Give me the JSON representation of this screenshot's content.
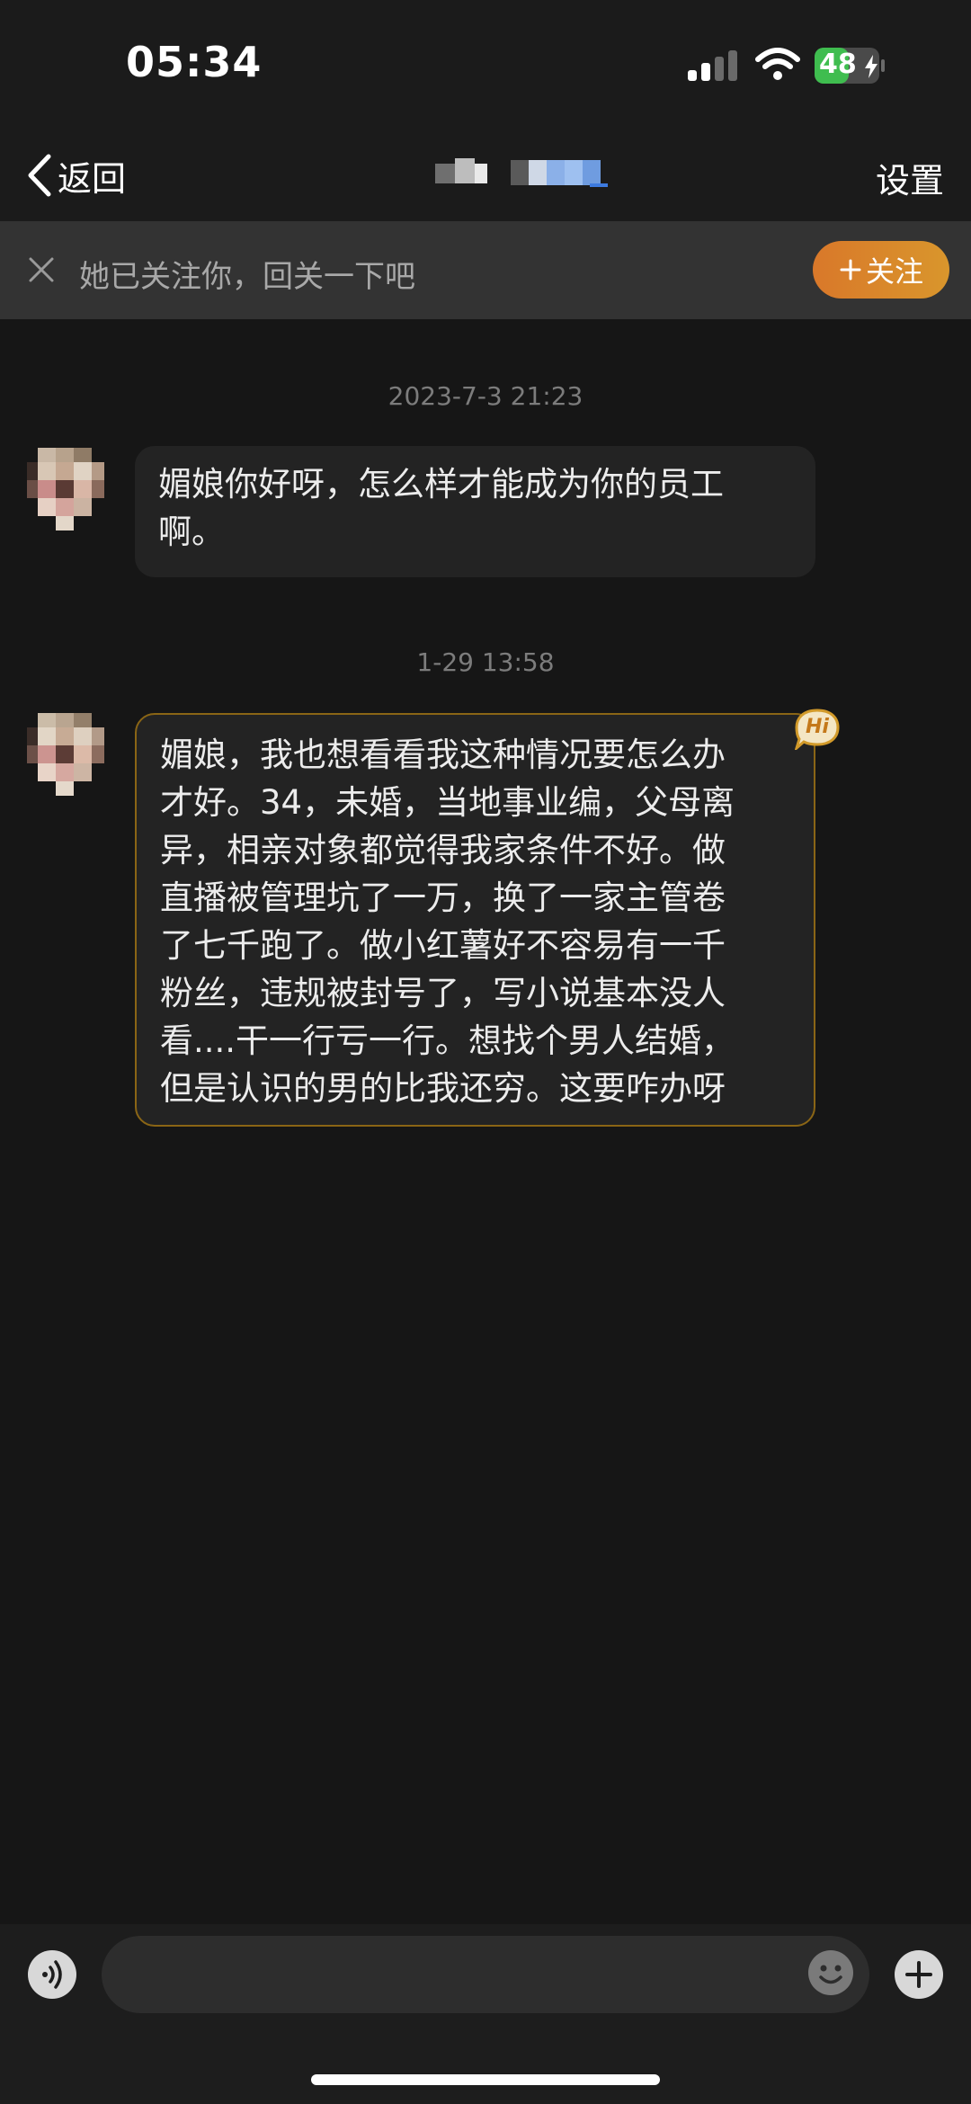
{
  "status": {
    "time": "05:34",
    "battery": "48"
  },
  "nav": {
    "back_label": "返回",
    "settings_label": "设置"
  },
  "banner": {
    "text": "她已关注你，回关一下吧",
    "follow_label": "关注"
  },
  "messages": [
    {
      "timestamp": "2023-7-3 21:23",
      "text": "媚娘你好呀，怎么样才能成为你的员工\n啊。"
    },
    {
      "timestamp": "1-29 13:58",
      "text": "媚娘，我也想看看我这种情况要怎么办\n才好。34，未婚，当地事业编，父母离\n异，相亲对象都觉得我家条件不好。做\n直播被管理坑了一万，换了一家主管卷\n了七千跑了。做小红薯好不容易有一千\n粉丝，违规被封号了，写小说基本没人\n看....干一行亏一行。想找个男人结婚，\n但是认识的男的比我还穷。这要咋办呀",
      "badge": "Hi"
    }
  ],
  "colors": {
    "accent": "#d9862b",
    "background": "#161616",
    "bubble": "#232323"
  }
}
